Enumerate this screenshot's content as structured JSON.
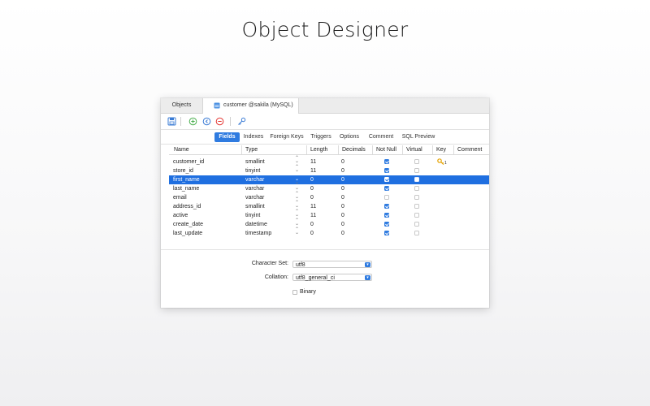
{
  "headline": "Object Designer",
  "tabs": {
    "objects": "Objects",
    "customer": "customer @sakila (MySQL)"
  },
  "toolbar": {
    "save_icon": "save-icon",
    "add_icon": "add-field-icon",
    "insert_icon": "insert-field-icon",
    "delete_icon": "delete-field-icon",
    "key_icon": "primary-key-icon"
  },
  "subtabs": [
    "Fields",
    "Indexes",
    "Foreign Keys",
    "Triggers",
    "Options",
    "Comment",
    "SQL Preview"
  ],
  "columns": [
    "Name",
    "Type",
    "Length",
    "Decimals",
    "Not Null",
    "Virtual",
    "Key",
    "Comment"
  ],
  "fields": [
    {
      "name": "customer_id",
      "type": "smallint",
      "length": "11",
      "decimals": "0",
      "not_null": true,
      "virtual": false,
      "key": "1"
    },
    {
      "name": "store_id",
      "type": "tinyint",
      "length": "11",
      "decimals": "0",
      "not_null": true,
      "virtual": false,
      "key": ""
    },
    {
      "name": "first_name",
      "type": "varchar",
      "length": "0",
      "decimals": "0",
      "not_null": true,
      "virtual": false,
      "key": ""
    },
    {
      "name": "last_name",
      "type": "varchar",
      "length": "0",
      "decimals": "0",
      "not_null": true,
      "virtual": false,
      "key": ""
    },
    {
      "name": "email",
      "type": "varchar",
      "length": "0",
      "decimals": "0",
      "not_null": false,
      "virtual": false,
      "key": ""
    },
    {
      "name": "address_id",
      "type": "smallint",
      "length": "11",
      "decimals": "0",
      "not_null": true,
      "virtual": false,
      "key": ""
    },
    {
      "name": "active",
      "type": "tinyint",
      "length": "11",
      "decimals": "0",
      "not_null": true,
      "virtual": false,
      "key": ""
    },
    {
      "name": "create_date",
      "type": "datetime",
      "length": "0",
      "decimals": "0",
      "not_null": true,
      "virtual": false,
      "key": ""
    },
    {
      "name": "last_update",
      "type": "timestamp",
      "length": "0",
      "decimals": "0",
      "not_null": true,
      "virtual": false,
      "key": ""
    }
  ],
  "selected_index": 2,
  "props": {
    "charset_label": "Character Set:",
    "charset_value": "utf8",
    "collation_label": "Collation:",
    "collation_value": "utf8_general_ci",
    "binary_label": "Binary",
    "binary_checked": false
  },
  "colors": {
    "accent": "#2f7be0",
    "selected_row": "#1f6fe0",
    "key": "#e5a300"
  }
}
